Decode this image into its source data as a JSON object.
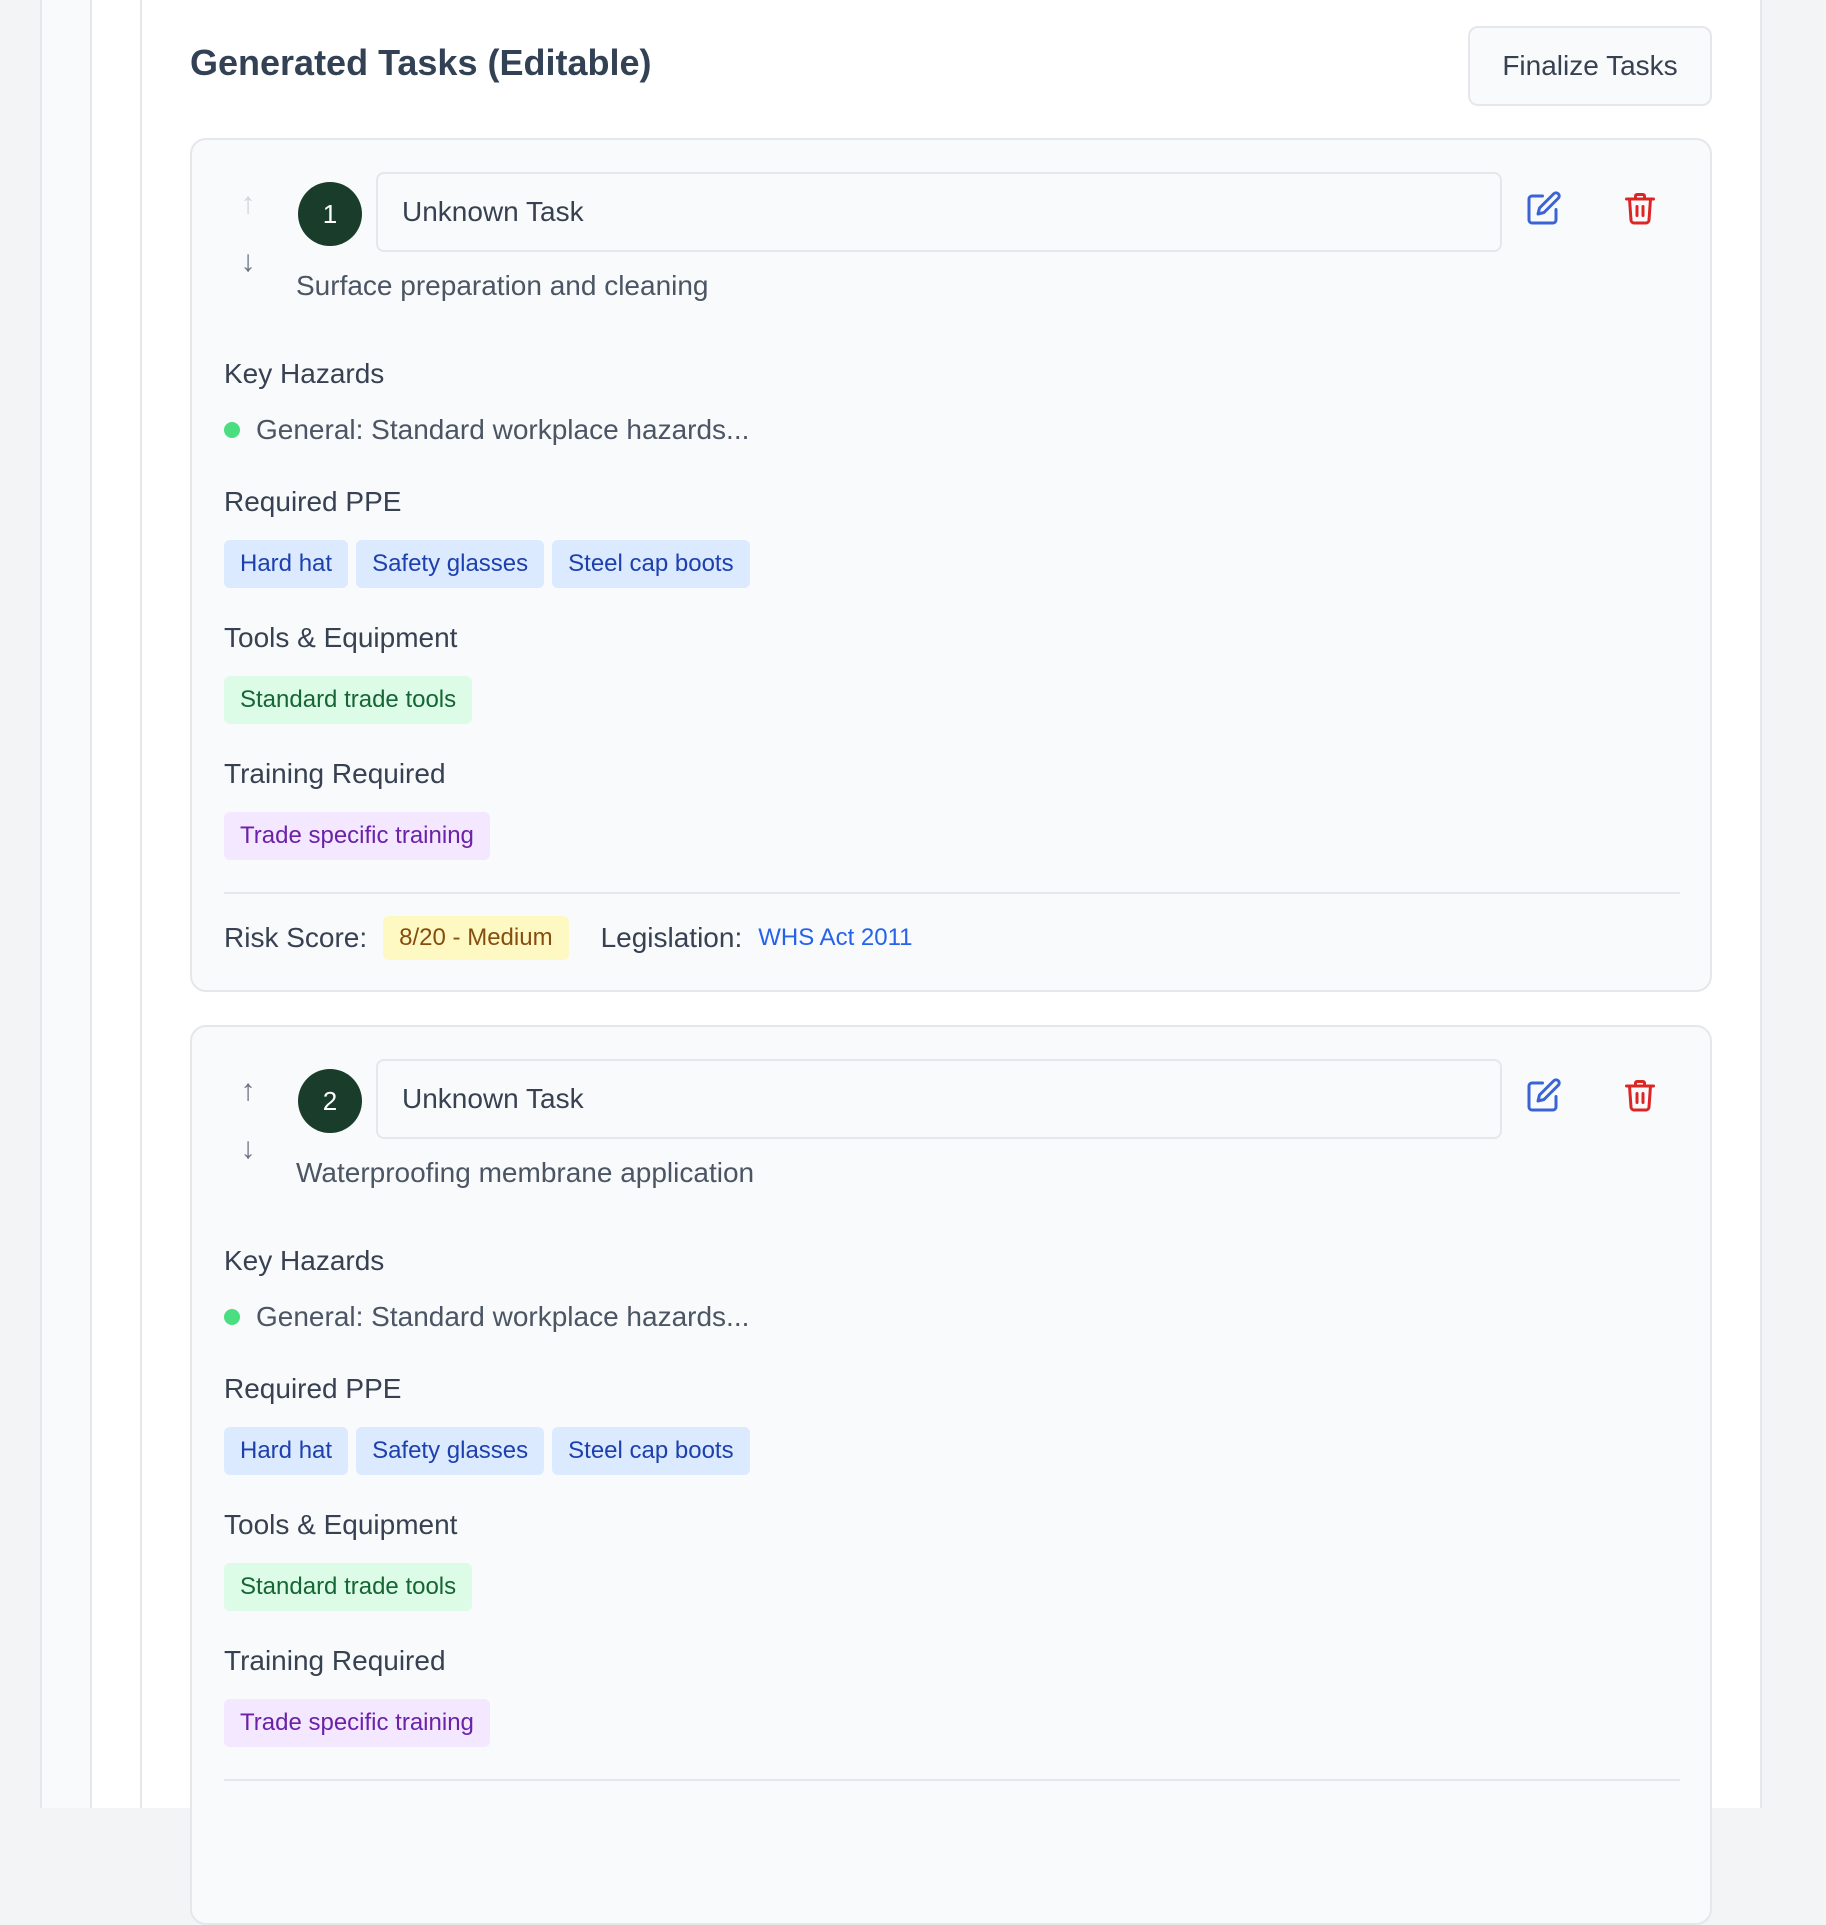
{
  "header": {
    "title": "Generated Tasks (Editable)",
    "finalize_label": "Finalize Tasks"
  },
  "colors": {
    "task_number_bg": "#1a3d2b",
    "edit_icon": "#3b63d6",
    "delete_icon": "#dc2626",
    "hazard_dot": "#4ade80",
    "ppe_chip_bg": "#dbeafe",
    "tool_chip_bg": "#dcfce7",
    "training_chip_bg": "#f3e8ff",
    "risk_badge_bg": "#fef9c3"
  },
  "labels": {
    "hazards": "Key Hazards",
    "ppe": "Required PPE",
    "tools": "Tools & Equipment",
    "training": "Training Required",
    "risk_score": "Risk Score:",
    "legislation": "Legislation:"
  },
  "icons": {
    "move_up": "arrow-up-icon",
    "move_down": "arrow-down-icon",
    "edit": "edit-icon",
    "delete": "trash-icon"
  },
  "tasks": [
    {
      "number": "1",
      "name": "Unknown Task",
      "description": "Surface preparation and cleaning",
      "hazards": [
        "General: Standard workplace hazards..."
      ],
      "ppe": [
        "Hard hat",
        "Safety glasses",
        "Steel cap boots"
      ],
      "tools": [
        "Standard trade tools"
      ],
      "training": [
        "Trade specific training"
      ],
      "risk_score": "8/20 - Medium",
      "legislation": "WHS Act 2011",
      "can_move_up": false
    },
    {
      "number": "2",
      "name": "Unknown Task",
      "description": "Waterproofing membrane application",
      "hazards": [
        "General: Standard workplace hazards..."
      ],
      "ppe": [
        "Hard hat",
        "Safety glasses",
        "Steel cap boots"
      ],
      "tools": [
        "Standard trade tools"
      ],
      "training": [
        "Trade specific training"
      ],
      "can_move_up": true
    }
  ]
}
